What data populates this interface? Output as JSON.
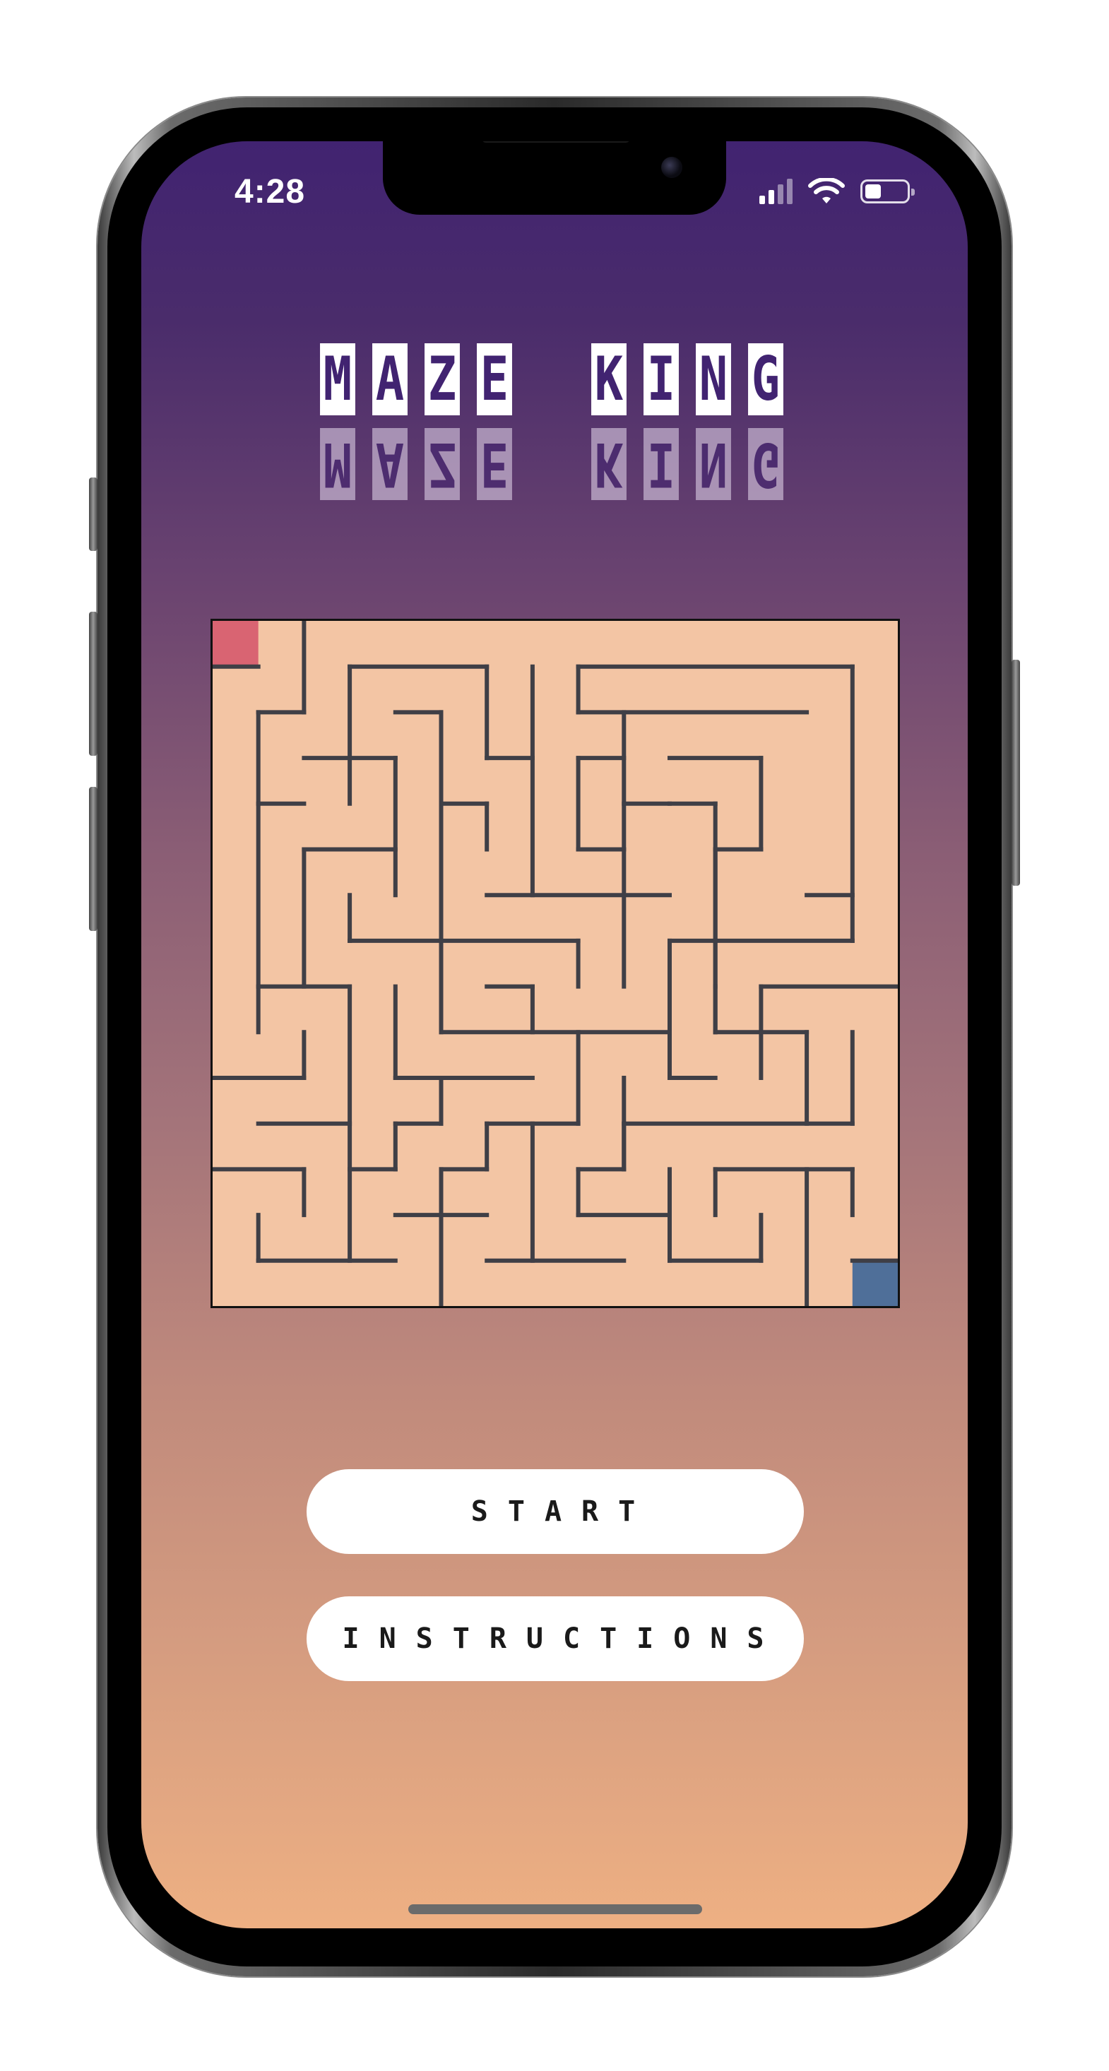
{
  "status_bar": {
    "time": "4:28",
    "icons": [
      "signal-icon",
      "wifi-icon",
      "battery-icon"
    ]
  },
  "logo": {
    "words": [
      "MAZE",
      "KING"
    ],
    "reflection_words": [
      "MAZE",
      "KING"
    ],
    "tile_color": "#ffffff",
    "letter_color": "#412371"
  },
  "maze": {
    "cells": 15,
    "start_color": "#d96472",
    "end_color": "#4f6f99",
    "path_color": "#f3c5a4",
    "wall_color": "#3f3f46"
  },
  "buttons": {
    "start_label": "START",
    "instructions_label": "INSTRUCTIONS"
  },
  "colors": {
    "gradient_top": "#412371",
    "gradient_bottom": "#eeb083",
    "button_bg": "#ffffff"
  }
}
